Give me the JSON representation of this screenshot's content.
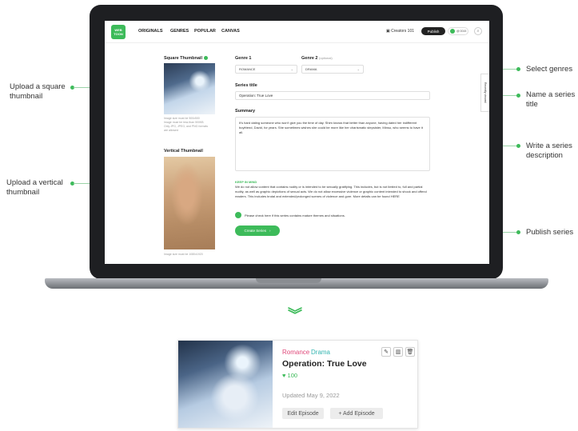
{
  "annotations": {
    "upload_square": "Upload a square\nthumbnail",
    "upload_vertical": "Upload a vertical\nthumbnail",
    "select_genres": "Select genres",
    "name_title": "Name a series\ntitle",
    "write_description": "Write a series\ndescription",
    "publish_series": "Publish series"
  },
  "nav": {
    "logo": "WEB TOON",
    "items": [
      "ORIGINALS",
      "GENRES",
      "POPULAR",
      "CANVAS"
    ],
    "creators": "Creators 101",
    "publish": "Publish",
    "user": "@ 0015"
  },
  "form": {
    "square_thumb_label": "Square Thumbnail",
    "square_hint": "Image size must be 500x500\nImage must be less than 500KB\nOnly JPG, JPEG, and PNG formats\nare allowed",
    "vertical_thumb_label": "Vertical Thumbnail",
    "vertical_hint": "Image size must be 1080x1920",
    "genre1_label": "Genre 1",
    "genre1_value": "ROMANCE",
    "genre2_label": "Genre 2",
    "genre2_optional": "(optional)",
    "genre2_value": "DRAMA",
    "title_label": "Series title",
    "title_value": "Operation: True Love",
    "summary_label": "Summary",
    "summary_value": "It's hard dating someone who won't give you the time of day. Shim knows that better than anyone, having dated her indifferent boyfriend, David, for years. She sometimes wishes she could be more like her charismatic stepsister, Minsu, who seems to have it all.",
    "policy_head": "KEEP IN MIND",
    "policy_text": "We do not allow content that contains nudity or is intended to be sexually gratifying. This includes, but is not limited to, full and partial nudity, as well as graphic depictions of sexual acts. We do not allow excessive violence or graphic content intended to shock and offend readers. This includes brutal and extended/prolonged scenes of violence and gore. More details can be found HERE",
    "mature_text": "Please check here if this series contains mature themes and situations.",
    "create_button": "Create Series",
    "side_tab": "Recently viewed"
  },
  "card": {
    "genre_a": "Romance",
    "genre_b": "Drama",
    "title": "Operation: True Love",
    "likes": "♥ 100",
    "updated": "Updated May 9, 2022",
    "edit_button": "Edit Episode",
    "add_button": "+ Add Episode"
  },
  "colors": {
    "accent": "#3dbb5a",
    "romance": "#e04a7b",
    "drama": "#34b5b0"
  }
}
